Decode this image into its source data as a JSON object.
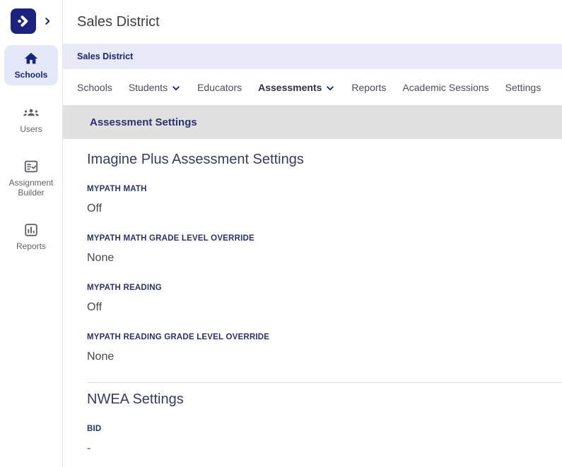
{
  "brand": {
    "navy": "#1a237e",
    "breadcrumb_bg": "#e8eaf7",
    "section_bar_bg": "#e1e1e1",
    "active_pill_bg": "#e5e8f8"
  },
  "sidebar": {
    "items": [
      {
        "label": "Schools",
        "icon": "home-icon",
        "active": true
      },
      {
        "label": "Users",
        "icon": "groups-icon",
        "active": false
      },
      {
        "label": "Assignment Builder",
        "icon": "assignment-check-icon",
        "active": false
      },
      {
        "label": "Reports",
        "icon": "bar-chart-icon",
        "active": false
      }
    ]
  },
  "header": {
    "title": "Sales District"
  },
  "breadcrumb": {
    "items": [
      "Sales District"
    ]
  },
  "tabs": [
    {
      "label": "Schools",
      "dropdown": false,
      "active": false
    },
    {
      "label": "Students",
      "dropdown": true,
      "active": false
    },
    {
      "label": "Educators",
      "dropdown": false,
      "active": false
    },
    {
      "label": "Assessments",
      "dropdown": true,
      "active": true
    },
    {
      "label": "Reports",
      "dropdown": false,
      "active": false
    },
    {
      "label": "Academic Sessions",
      "dropdown": false,
      "active": false
    },
    {
      "label": "Settings",
      "dropdown": false,
      "active": false
    }
  ],
  "section_bar": {
    "title": "Assessment Settings"
  },
  "content": {
    "sections": [
      {
        "heading": "Imagine Plus Assessment Settings",
        "fields": [
          {
            "label": "MYPATH MATH",
            "value": "Off"
          },
          {
            "label": "MYPATH MATH GRADE LEVEL OVERRIDE",
            "value": "None"
          },
          {
            "label": "MYPATH READING",
            "value": "Off"
          },
          {
            "label": "MYPATH READING GRADE LEVEL OVERRIDE",
            "value": "None"
          }
        ]
      },
      {
        "heading": "NWEA Settings",
        "fields": [
          {
            "label": "BID",
            "value": "-"
          }
        ]
      }
    ]
  }
}
